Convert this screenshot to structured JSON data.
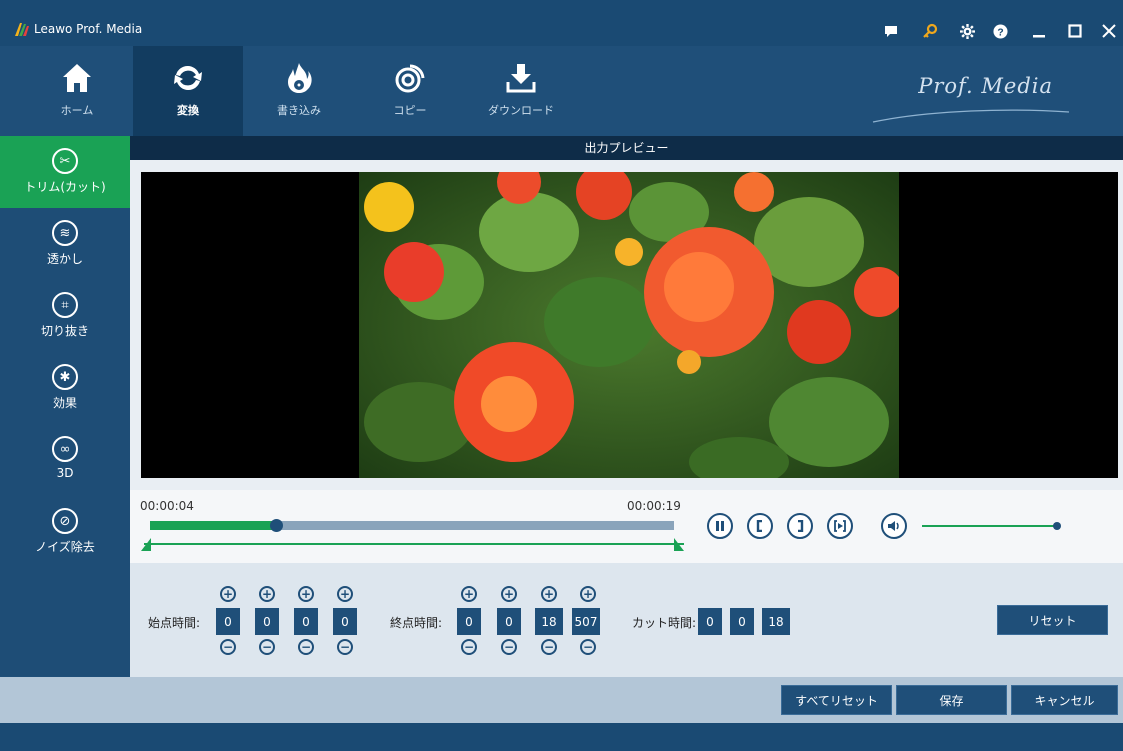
{
  "app": {
    "title": "Leawo Prof. Media",
    "brand": "Prof. Media"
  },
  "titlebar_icons": [
    "chat-icon",
    "key-icon",
    "gear-icon",
    "help-icon",
    "minimize-icon",
    "maximize-icon",
    "close-icon"
  ],
  "topnav": {
    "items": [
      {
        "label": "ホーム",
        "icon": "home-icon"
      },
      {
        "label": "変換",
        "icon": "convert-icon",
        "active": true
      },
      {
        "label": "書き込み",
        "icon": "burn-icon"
      },
      {
        "label": "コピー",
        "icon": "copy-icon"
      },
      {
        "label": "ダウンロード",
        "icon": "download-icon"
      }
    ]
  },
  "sidebar": {
    "items": [
      {
        "label": "トリム(カット)",
        "icon": "scissors-icon",
        "active": true
      },
      {
        "label": "透かし",
        "icon": "watermark-icon"
      },
      {
        "label": "切り抜き",
        "icon": "crop-icon"
      },
      {
        "label": "効果",
        "icon": "effect-icon"
      },
      {
        "label": "3D",
        "icon": "3d-glasses-icon"
      },
      {
        "label": "ノイズ除去",
        "icon": "denoise-icon"
      }
    ]
  },
  "preview": {
    "header": "出力プレビュー"
  },
  "timeline": {
    "start_time": "00:00:04",
    "end_time": "00:00:19",
    "progress": 0.24,
    "volume": 1.0
  },
  "trim": {
    "start_label": "始点時間:",
    "start_values": [
      "0",
      "0",
      "0",
      "0"
    ],
    "end_label": "終点時間:",
    "end_values": [
      "0",
      "0",
      "18",
      "507"
    ],
    "cut_label": "カット時間:",
    "cut_values": [
      "0",
      "0",
      "18"
    ],
    "reset_label": "リセット",
    "plus": "+",
    "minus": "−"
  },
  "footer_buttons": {
    "reset_all": "すべてリセット",
    "save": "保存",
    "cancel": "キャンセル"
  },
  "colors": {
    "primary": "#1f4f79",
    "accent": "#1aa255"
  }
}
